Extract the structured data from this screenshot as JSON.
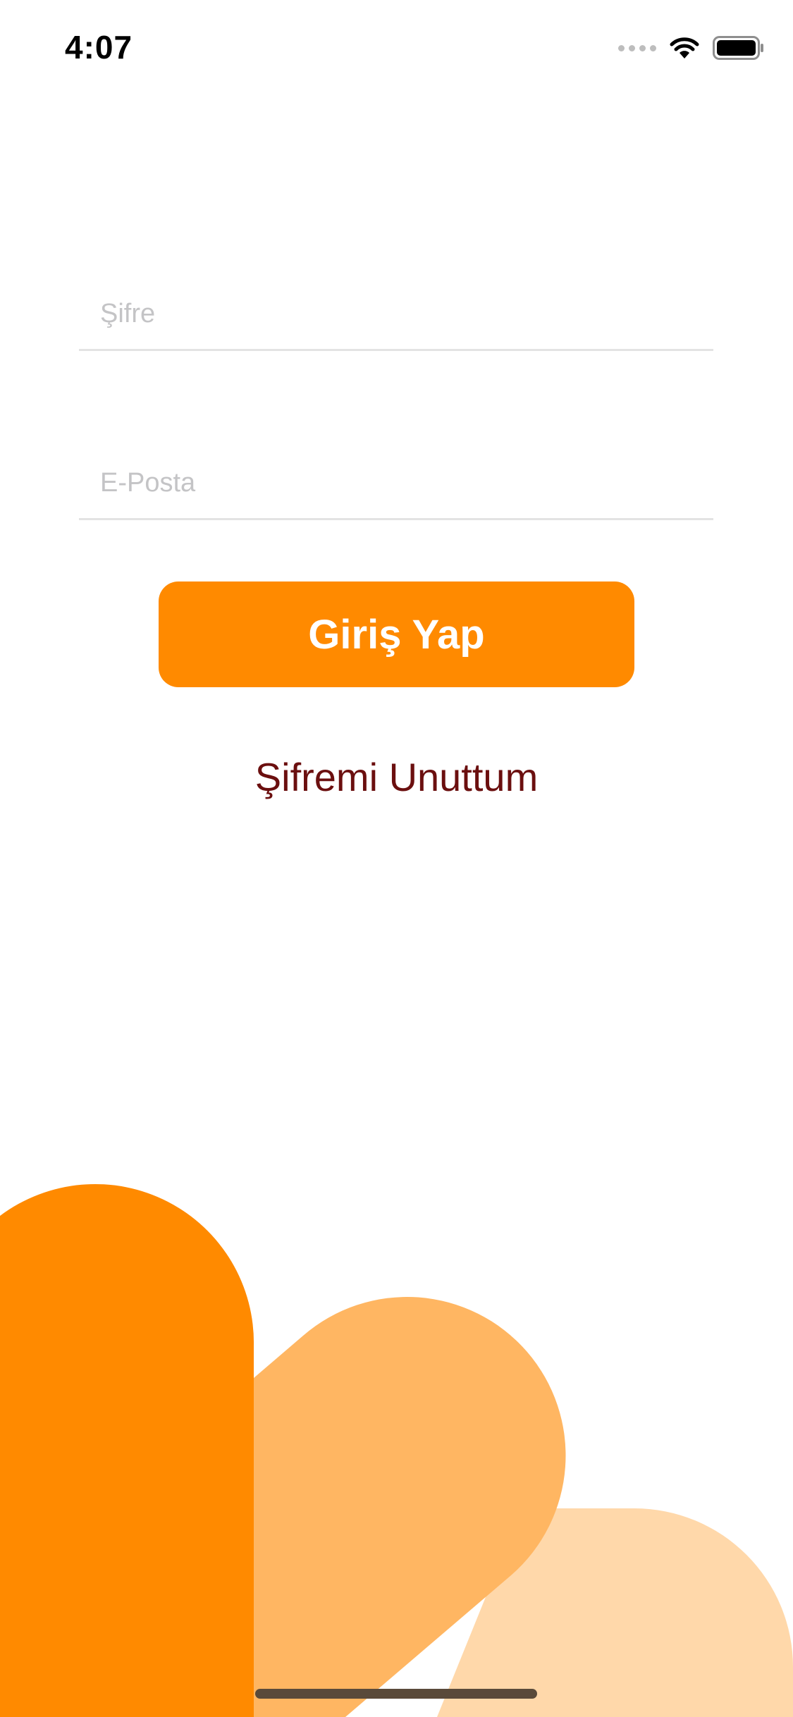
{
  "status_bar": {
    "time": "4:07",
    "icons": [
      "signal-icon",
      "wifi-icon",
      "battery-icon"
    ]
  },
  "form": {
    "password_placeholder": "Şifre",
    "email_placeholder": "E-Posta",
    "login_label": "Giriş Yap",
    "forgot_label": "Şifremi Unuttum"
  },
  "colors": {
    "accent": "#FF8A00",
    "accent_mid": "#FFB662",
    "accent_light": "#FFD8AA",
    "link": "#6B0F0F"
  }
}
